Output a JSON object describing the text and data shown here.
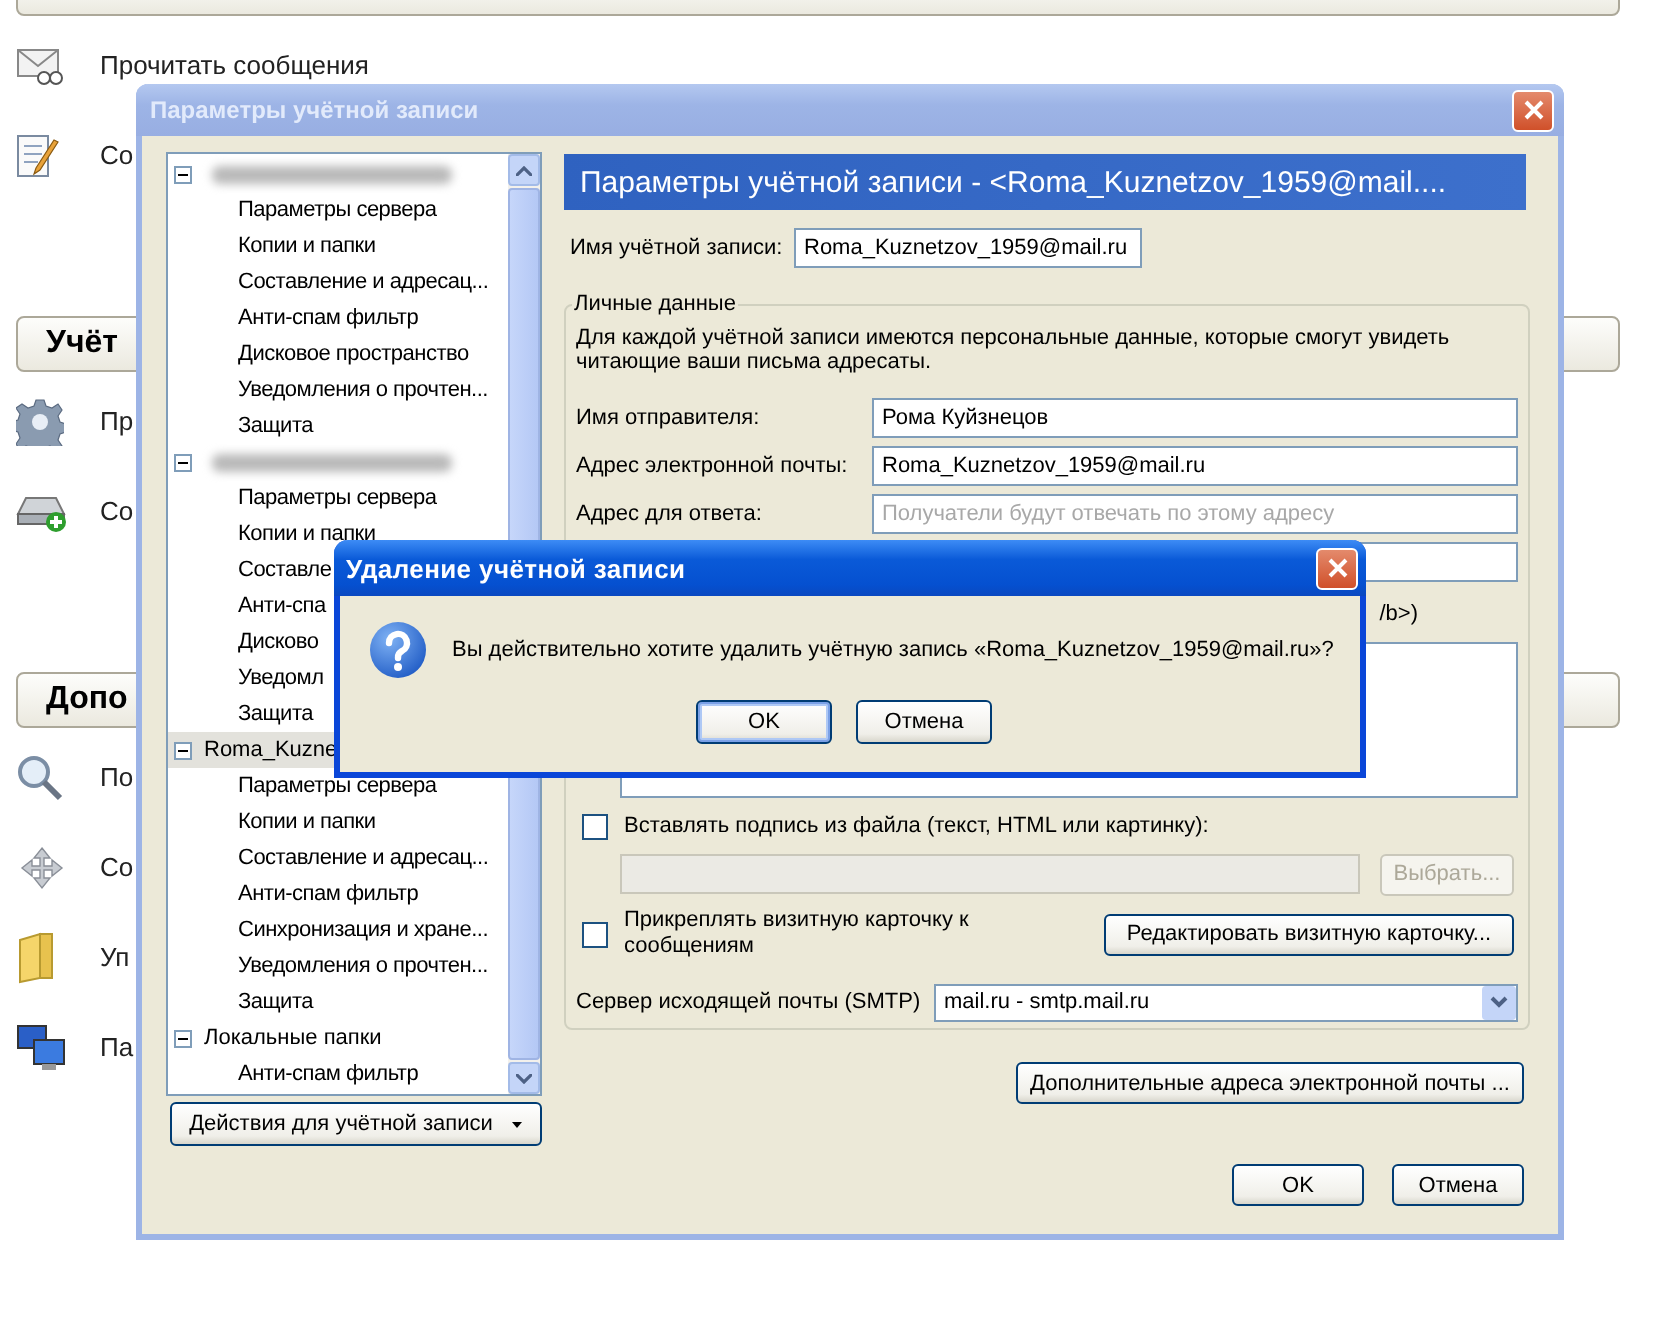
{
  "background": {
    "items": [
      {
        "kind": "header"
      },
      {
        "kind": "item",
        "label": "Прочитать сообщения"
      },
      {
        "kind": "item",
        "label": "Со"
      },
      {
        "kind": "header",
        "title": "Учёт"
      },
      {
        "kind": "item",
        "label": "Пр"
      },
      {
        "kind": "item",
        "label": "Со"
      },
      {
        "kind": "header",
        "title": "Допо"
      },
      {
        "kind": "item",
        "label": "По"
      },
      {
        "kind": "item",
        "label": "Со"
      },
      {
        "kind": "item",
        "label": "Уп"
      },
      {
        "kind": "item",
        "label": "Па"
      }
    ]
  },
  "account_window": {
    "title": "Параметры учётной записи",
    "active": false,
    "tree": [
      {
        "kind": "redacted",
        "expanded": true,
        "selected": false,
        "children": [
          {
            "label": "Параметры сервера",
            "selected": false
          },
          {
            "label": "Копии и папки",
            "selected": false
          },
          {
            "label": "Составление и адресац...",
            "selected": false
          },
          {
            "label": "Анти-спам фильтр",
            "selected": false
          },
          {
            "label": "Дисковое пространство",
            "selected": false
          },
          {
            "label": "Уведомления о прочтен...",
            "selected": false
          },
          {
            "label": "Защита",
            "selected": false
          }
        ]
      },
      {
        "kind": "redacted",
        "expanded": true,
        "selected": false,
        "children": [
          {
            "label": "Параметры сервера",
            "selected": false
          },
          {
            "label": "Копии и папки",
            "selected": false
          },
          {
            "label": "Составле",
            "selected": false
          },
          {
            "label": "Анти-спа",
            "selected": false
          },
          {
            "label": "Дисково",
            "selected": false
          },
          {
            "label": "Уведомл",
            "selected": false
          },
          {
            "label": "Защита",
            "selected": false
          }
        ]
      },
      {
        "kind": "account",
        "label": "Roma_Kuzne",
        "expanded": true,
        "selected": true,
        "children": [
          {
            "label": "Параметры сервера",
            "selected": false
          },
          {
            "label": "Копии и папки",
            "selected": false
          },
          {
            "label": "Составление и адресац...",
            "selected": false
          },
          {
            "label": "Анти-спам фильтр",
            "selected": false
          },
          {
            "label": "Синхронизация и хране...",
            "selected": false
          },
          {
            "label": "Уведомления о прочтен...",
            "selected": false
          },
          {
            "label": "Защита",
            "selected": false
          }
        ]
      },
      {
        "kind": "account",
        "label": "Локальные папки",
        "expanded": true,
        "selected": false,
        "children": [
          {
            "label": "Анти-спам фильтр",
            "selected": false
          }
        ]
      }
    ],
    "actions_button": "Действия для учётной записи",
    "panel": {
      "title": "Параметры учётной записи - <Roma_Kuznetzov_1959@mail....",
      "account_name": {
        "label": "Имя учётной записи:",
        "value": "Roma_Kuznetzov_1959@mail.ru"
      },
      "personal": {
        "legend": "Личные данные",
        "description": "Для каждой учётной записи имеются персональные данные, которые смогут увидеть читающие ваши письма адресаты.",
        "rows": [
          {
            "kind": "field",
            "label": "Имя отправителя:",
            "value": "Рома Куйзнецов"
          },
          {
            "kind": "field",
            "label": "Адрес электронной почты:",
            "value": "Roma_Kuznetzov_1959@mail.ru"
          },
          {
            "kind": "field",
            "label": "Адрес для ответа:",
            "placeholder": "Получатели будут отвечать по этому адресу"
          },
          {
            "kind": "field"
          },
          {
            "kind": "note",
            "text": "/b>)"
          },
          {
            "kind": "textarea"
          },
          {
            "kind": "checkbox",
            "label": "Вставлять подпись из файла (текст, HTML или картинку):",
            "checked": false
          },
          {
            "kind": "file",
            "button": "Выбрать...",
            "disabled": true
          },
          {
            "kind": "checkbox_button",
            "label": "Прикреплять визитную карточку к сообщениям",
            "checked": false,
            "button": "Редактировать визитную карточку..."
          },
          {
            "kind": "select",
            "label": "Сервер исходящей почты (SMTP)",
            "value": "mail.ru - smtp.mail.ru"
          }
        ]
      },
      "extra_button": "Дополнительные адреса электронной почты ...",
      "buttons": [
        "OK",
        "Отмена"
      ]
    }
  },
  "dialog": {
    "title": "Удаление учётной записи",
    "active": true,
    "message": "Вы действительно хотите удалить учётную запись «Roma_Kuznetzov_1959@mail.ru»?",
    "buttons": [
      {
        "label": "OK",
        "default": true
      },
      {
        "label": "Отмена",
        "default": false
      }
    ]
  }
}
